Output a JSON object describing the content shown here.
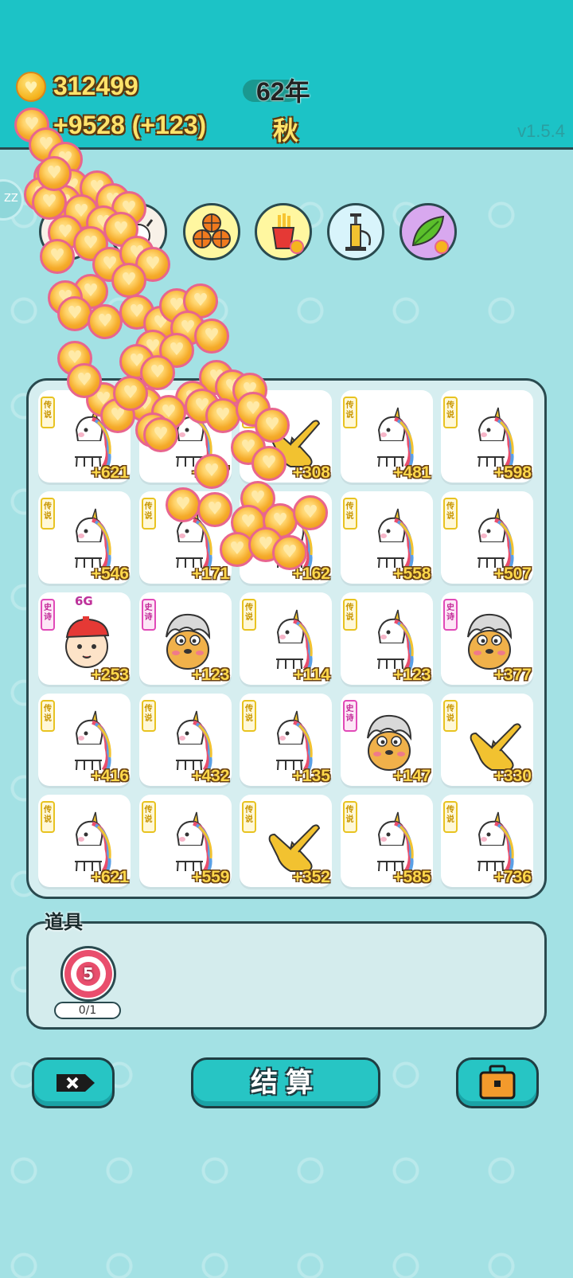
{
  "header": {
    "coins": "312499",
    "income": "+9528 (+123)",
    "year": "62年",
    "season": "秋",
    "version": "v1.5.4"
  },
  "side_badge": "ZZ",
  "bonus_icons": [
    "cow-icon",
    "basketballs-icon",
    "fries-icon",
    "pump-icon",
    "leaf-icon"
  ],
  "board": {
    "cells": [
      {
        "tag": "传说",
        "rarity": "legend",
        "char": "unicorn",
        "value": "+621"
      },
      {
        "tag": "传说",
        "rarity": "legend",
        "char": "unicorn",
        "value": "+507"
      },
      {
        "tag": "传说",
        "rarity": "legend",
        "char": "pointer-hand",
        "value": "+308"
      },
      {
        "tag": "传说",
        "rarity": "legend",
        "char": "unicorn",
        "value": "+481"
      },
      {
        "tag": "传说",
        "rarity": "legend",
        "char": "unicorn",
        "value": "+598"
      },
      {
        "tag": "传说",
        "rarity": "legend",
        "char": "unicorn",
        "value": "+546"
      },
      {
        "tag": "传说",
        "rarity": "legend",
        "char": "unicorn",
        "value": "+171"
      },
      {
        "tag": "传说",
        "rarity": "legend",
        "char": "unicorn",
        "value": "+162"
      },
      {
        "tag": "传说",
        "rarity": "legend",
        "char": "unicorn",
        "value": "+558"
      },
      {
        "tag": "传说",
        "rarity": "legend",
        "char": "unicorn",
        "value": "+507"
      },
      {
        "tag": "史诗",
        "rarity": "epic",
        "char": "boy-cap",
        "value": "+253",
        "badge": "6G"
      },
      {
        "tag": "史诗",
        "rarity": "epic",
        "char": "chick",
        "value": "+123"
      },
      {
        "tag": "传说",
        "rarity": "legend",
        "char": "unicorn",
        "value": "+114"
      },
      {
        "tag": "传说",
        "rarity": "legend",
        "char": "unicorn",
        "value": "+123"
      },
      {
        "tag": "史诗",
        "rarity": "epic",
        "char": "chick",
        "value": "+377"
      },
      {
        "tag": "传说",
        "rarity": "legend",
        "char": "unicorn",
        "value": "+416"
      },
      {
        "tag": "传说",
        "rarity": "legend",
        "char": "unicorn",
        "value": "+432"
      },
      {
        "tag": "传说",
        "rarity": "legend",
        "char": "unicorn",
        "value": "+135"
      },
      {
        "tag": "史诗",
        "rarity": "epic",
        "char": "chick",
        "value": "+147"
      },
      {
        "tag": "传说",
        "rarity": "legend",
        "char": "pointer-hand",
        "value": "+330"
      },
      {
        "tag": "传说",
        "rarity": "legend",
        "char": "unicorn",
        "value": "+621"
      },
      {
        "tag": "传说",
        "rarity": "legend",
        "char": "unicorn",
        "value": "+559"
      },
      {
        "tag": "传说",
        "rarity": "legend",
        "char": "pointer-hand",
        "value": "+352"
      },
      {
        "tag": "传说",
        "rarity": "legend",
        "char": "unicorn",
        "value": "+585"
      },
      {
        "tag": "传说",
        "rarity": "legend",
        "char": "unicorn",
        "value": "+736"
      }
    ]
  },
  "items": {
    "title": "道具",
    "target_count": "5",
    "target_progress": "0/1"
  },
  "buttons": {
    "settle_label": "结算"
  },
  "colors": {
    "header_bg": "#1cc3c6",
    "page_bg": "#a3e1e4",
    "coin_gold": "#f5b51f",
    "value_text": "#ffd84a",
    "legend_tag": "#e8c321",
    "epic_tag": "#e14ab8"
  }
}
